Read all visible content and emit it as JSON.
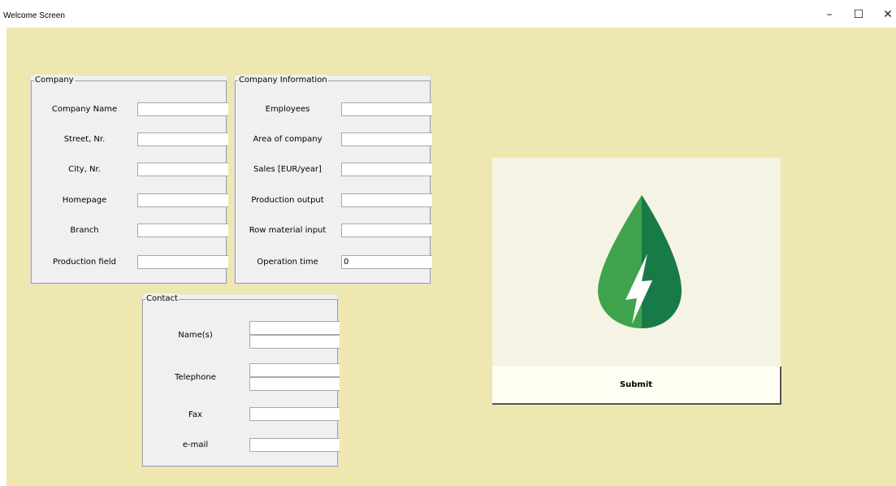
{
  "window": {
    "title": "Welcome Screen",
    "minimize": "–",
    "maximize": "☐",
    "close": "✕"
  },
  "company": {
    "legend": "Company",
    "fields": [
      {
        "label": "Company Name",
        "value": ""
      },
      {
        "label": "Street, Nr.",
        "value": ""
      },
      {
        "label": "City, Nr.",
        "value": ""
      },
      {
        "label": "Homepage",
        "value": ""
      },
      {
        "label": "Branch",
        "value": ""
      },
      {
        "label": "Production field",
        "value": ""
      }
    ]
  },
  "company_info": {
    "legend": "Company Information",
    "fields": [
      {
        "label": "Employees",
        "value": ""
      },
      {
        "label": "Area of company",
        "value": ""
      },
      {
        "label": "Sales [EUR/year]",
        "value": ""
      },
      {
        "label": "Production output",
        "value": ""
      },
      {
        "label": "Row material input",
        "value": ""
      },
      {
        "label": "Operation time",
        "value": "0"
      }
    ]
  },
  "contact": {
    "legend": "Contact",
    "names_label": "Name(s)",
    "names_values": [
      "",
      ""
    ],
    "telephone_label": "Telephone",
    "telephone_values": [
      "",
      ""
    ],
    "fax_label": "Fax",
    "fax_value": "",
    "email_label": "e-mail",
    "email_value": ""
  },
  "logo": {
    "icon": "green-leaf-lightning-icon",
    "colors": {
      "leaf_light": "#3fa34d",
      "leaf_dark": "#177a47",
      "bolt": "#ffffff"
    }
  },
  "submit": {
    "label": "Submit"
  },
  "colors": {
    "background": "#efe7b0",
    "group_bg": "#f0f0f0",
    "panel_bg": "#f5f4e4",
    "button_bg": "#fefef2"
  }
}
